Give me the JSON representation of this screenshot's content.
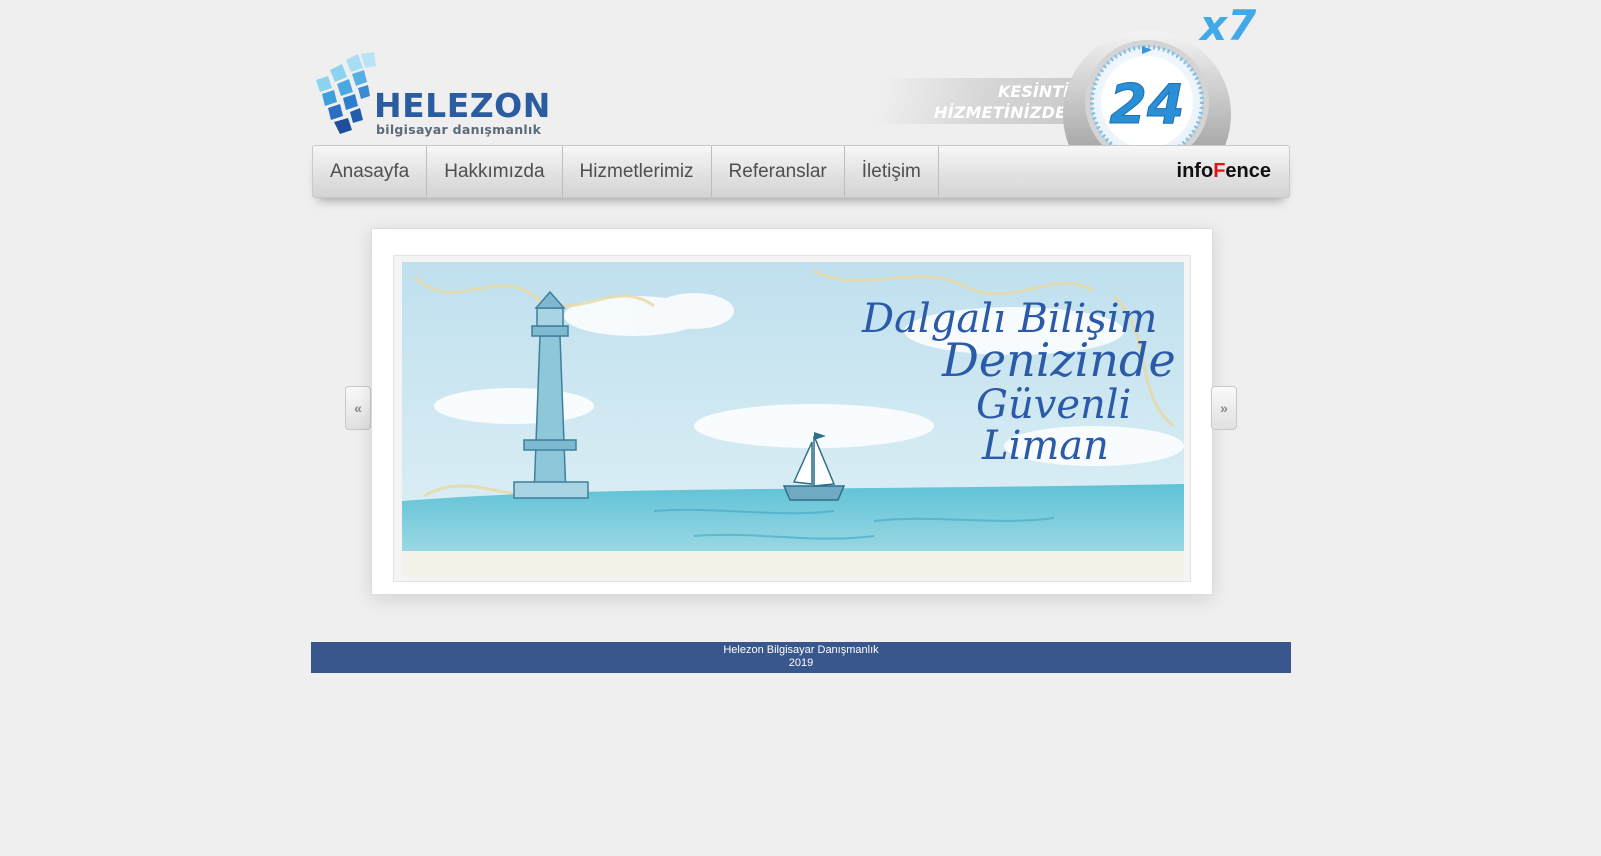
{
  "header": {
    "logo_title": "HELEZON",
    "logo_subtitle": "bilgisayar danışmanlık",
    "badge_line1": "KESİNTİSİZ",
    "badge_line2": "HİZMETİNİZDEYİZ",
    "badge_number": "24",
    "badge_multiplier": "x7"
  },
  "nav": {
    "items": [
      "Anasayfa",
      "Hakkımızda",
      "Hizmetlerimiz",
      "Referanslar",
      "İletişim"
    ],
    "brand_pre": "info",
    "brand_red": "F",
    "brand_post": "ence"
  },
  "slider": {
    "line1": "Dalgalı Bilişim",
    "line2": "Denizinde",
    "line3": "Güvenli",
    "line4": "Liman",
    "prev_label": "«",
    "next_label": "»"
  },
  "footer": {
    "company": "Helezon Bilgisayar Danışmanlık",
    "year": "2019"
  },
  "colors": {
    "footer_bg": "#39578c",
    "logo_blue": "#2a5ca0",
    "brand_red": "#e11414"
  }
}
